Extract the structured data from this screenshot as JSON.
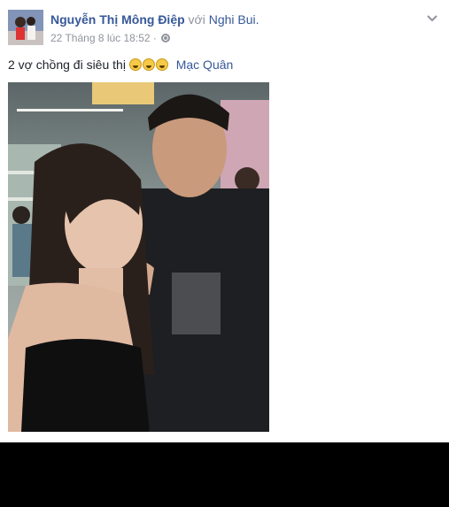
{
  "post": {
    "author": "Nguyễn Thị Mông Điệp",
    "with_text": "với",
    "tagged": "Nghi Bui.",
    "timestamp": "22 Tháng 8 lúc 18:52 ·",
    "text": "2 vợ chồng đi siêu thị",
    "mention": "Mạc Quân",
    "emoji_count": 3
  },
  "icons": {
    "privacy": "globe-icon",
    "options": "chevron-down-icon",
    "emoji": "laughing-face-icon"
  },
  "colors": {
    "link": "#365899",
    "muted": "#90949c",
    "text": "#1d2129",
    "background_bottom": "#000000"
  }
}
